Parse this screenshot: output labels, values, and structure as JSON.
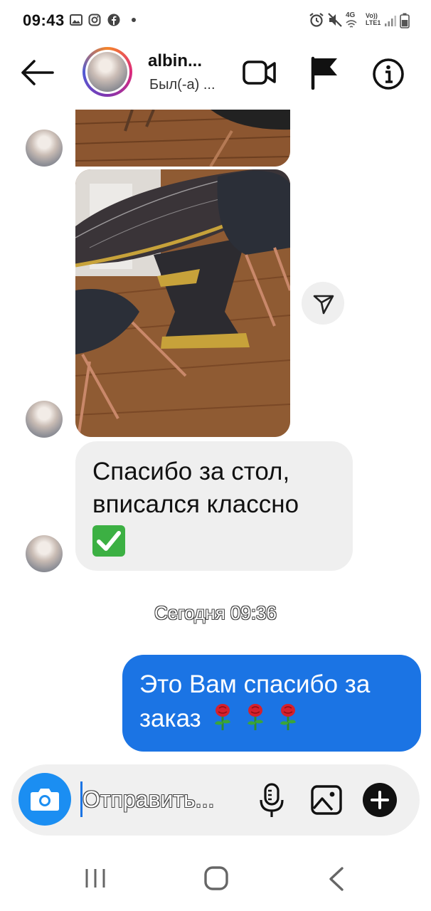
{
  "status_bar": {
    "time": "09:43",
    "left_icons": [
      "gallery-icon",
      "instagram-icon",
      "facebook-icon",
      "dot-icon"
    ],
    "right_icons": [
      "alarm-icon",
      "mute-icon",
      "wifi-4g-icon",
      "volte-icon",
      "signal-icon",
      "battery-icon"
    ],
    "net_label": "4G",
    "volte_label_1": "Vo))",
    "volte_label_2": "LTE1"
  },
  "header": {
    "contact_name": "albin...",
    "contact_status": "Был(-а) ..."
  },
  "messages": {
    "incoming_text": "Спасибо за стол, вписался классно",
    "date_separator": "Сегодня 09:36",
    "outgoing_text": "Это Вам спасибо за заказ"
  },
  "composer": {
    "placeholder": "Отправить..."
  },
  "colors": {
    "outgoing_bubble": "#1b74e4",
    "incoming_bubble": "#efefef",
    "camera_button": "#1b8ef2",
    "check_emoji": "#3cb043"
  }
}
